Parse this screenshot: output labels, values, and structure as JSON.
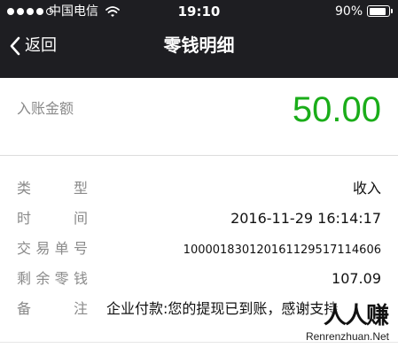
{
  "status_bar": {
    "carrier": "中国电信",
    "time": "19:10",
    "battery_percent": "90%",
    "signal_bars_filled": 4,
    "signal_bars_total": 5,
    "battery_level": 0.9
  },
  "nav": {
    "back_label": "返回",
    "title": "零钱明细"
  },
  "amount": {
    "label": "入账金额",
    "value": "50.00",
    "color": "#1aad19"
  },
  "details": [
    {
      "label_chars": [
        "类",
        "型"
      ],
      "value": "收入"
    },
    {
      "label_chars": [
        "时",
        "间"
      ],
      "value": "2016-11-29 16:14:17"
    },
    {
      "label_chars": [
        "交",
        "易",
        "单",
        "号"
      ],
      "value": "100001830120161129517114606"
    },
    {
      "label_chars": [
        "剩",
        "余",
        "零",
        "钱"
      ],
      "value": "107.09"
    },
    {
      "label_chars": [
        "备",
        "注"
      ],
      "value": "企业付款:您的提现已到账，感谢支持"
    }
  ],
  "watermark": {
    "logo": "人人赚",
    "text": "Renrenzhuan.Net"
  },
  "colors": {
    "header_bg": "#1e1e22",
    "label_gray": "#8a8a8a",
    "accent_green": "#1aad19"
  }
}
